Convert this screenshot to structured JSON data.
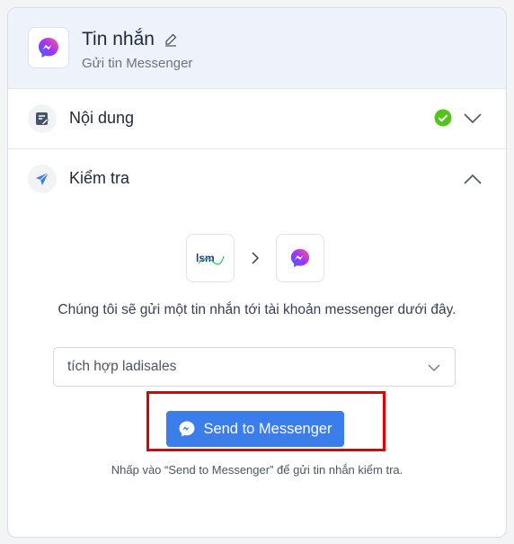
{
  "header": {
    "title": "Tin nhắn",
    "subtitle": "Gửi tin Messenger",
    "logo_icon": "messenger-icon",
    "edit_icon": "pencil-icon"
  },
  "sections": {
    "content": {
      "label": "Nội dung",
      "status": "complete",
      "expanded": false
    },
    "test": {
      "label": "Kiểm tra",
      "expanded": true
    }
  },
  "test_panel": {
    "source_logo_text": "lsm",
    "target_icon": "messenger-icon",
    "description": "Chúng tôi sẽ gửi một tin nhắn tới tài khoản messenger dưới đây.",
    "account_select": {
      "selected": "tích hợp ladisales"
    },
    "send_button": {
      "label": "Send to Messenger"
    },
    "hint": "Nhấp vào “Send to Messenger” để gửi tin nhắn kiểm tra."
  },
  "colors": {
    "accent_blue": "#3b7de9",
    "success_green": "#52c41a",
    "highlight_red": "#e00000",
    "header_bg": "#eef3fb"
  }
}
